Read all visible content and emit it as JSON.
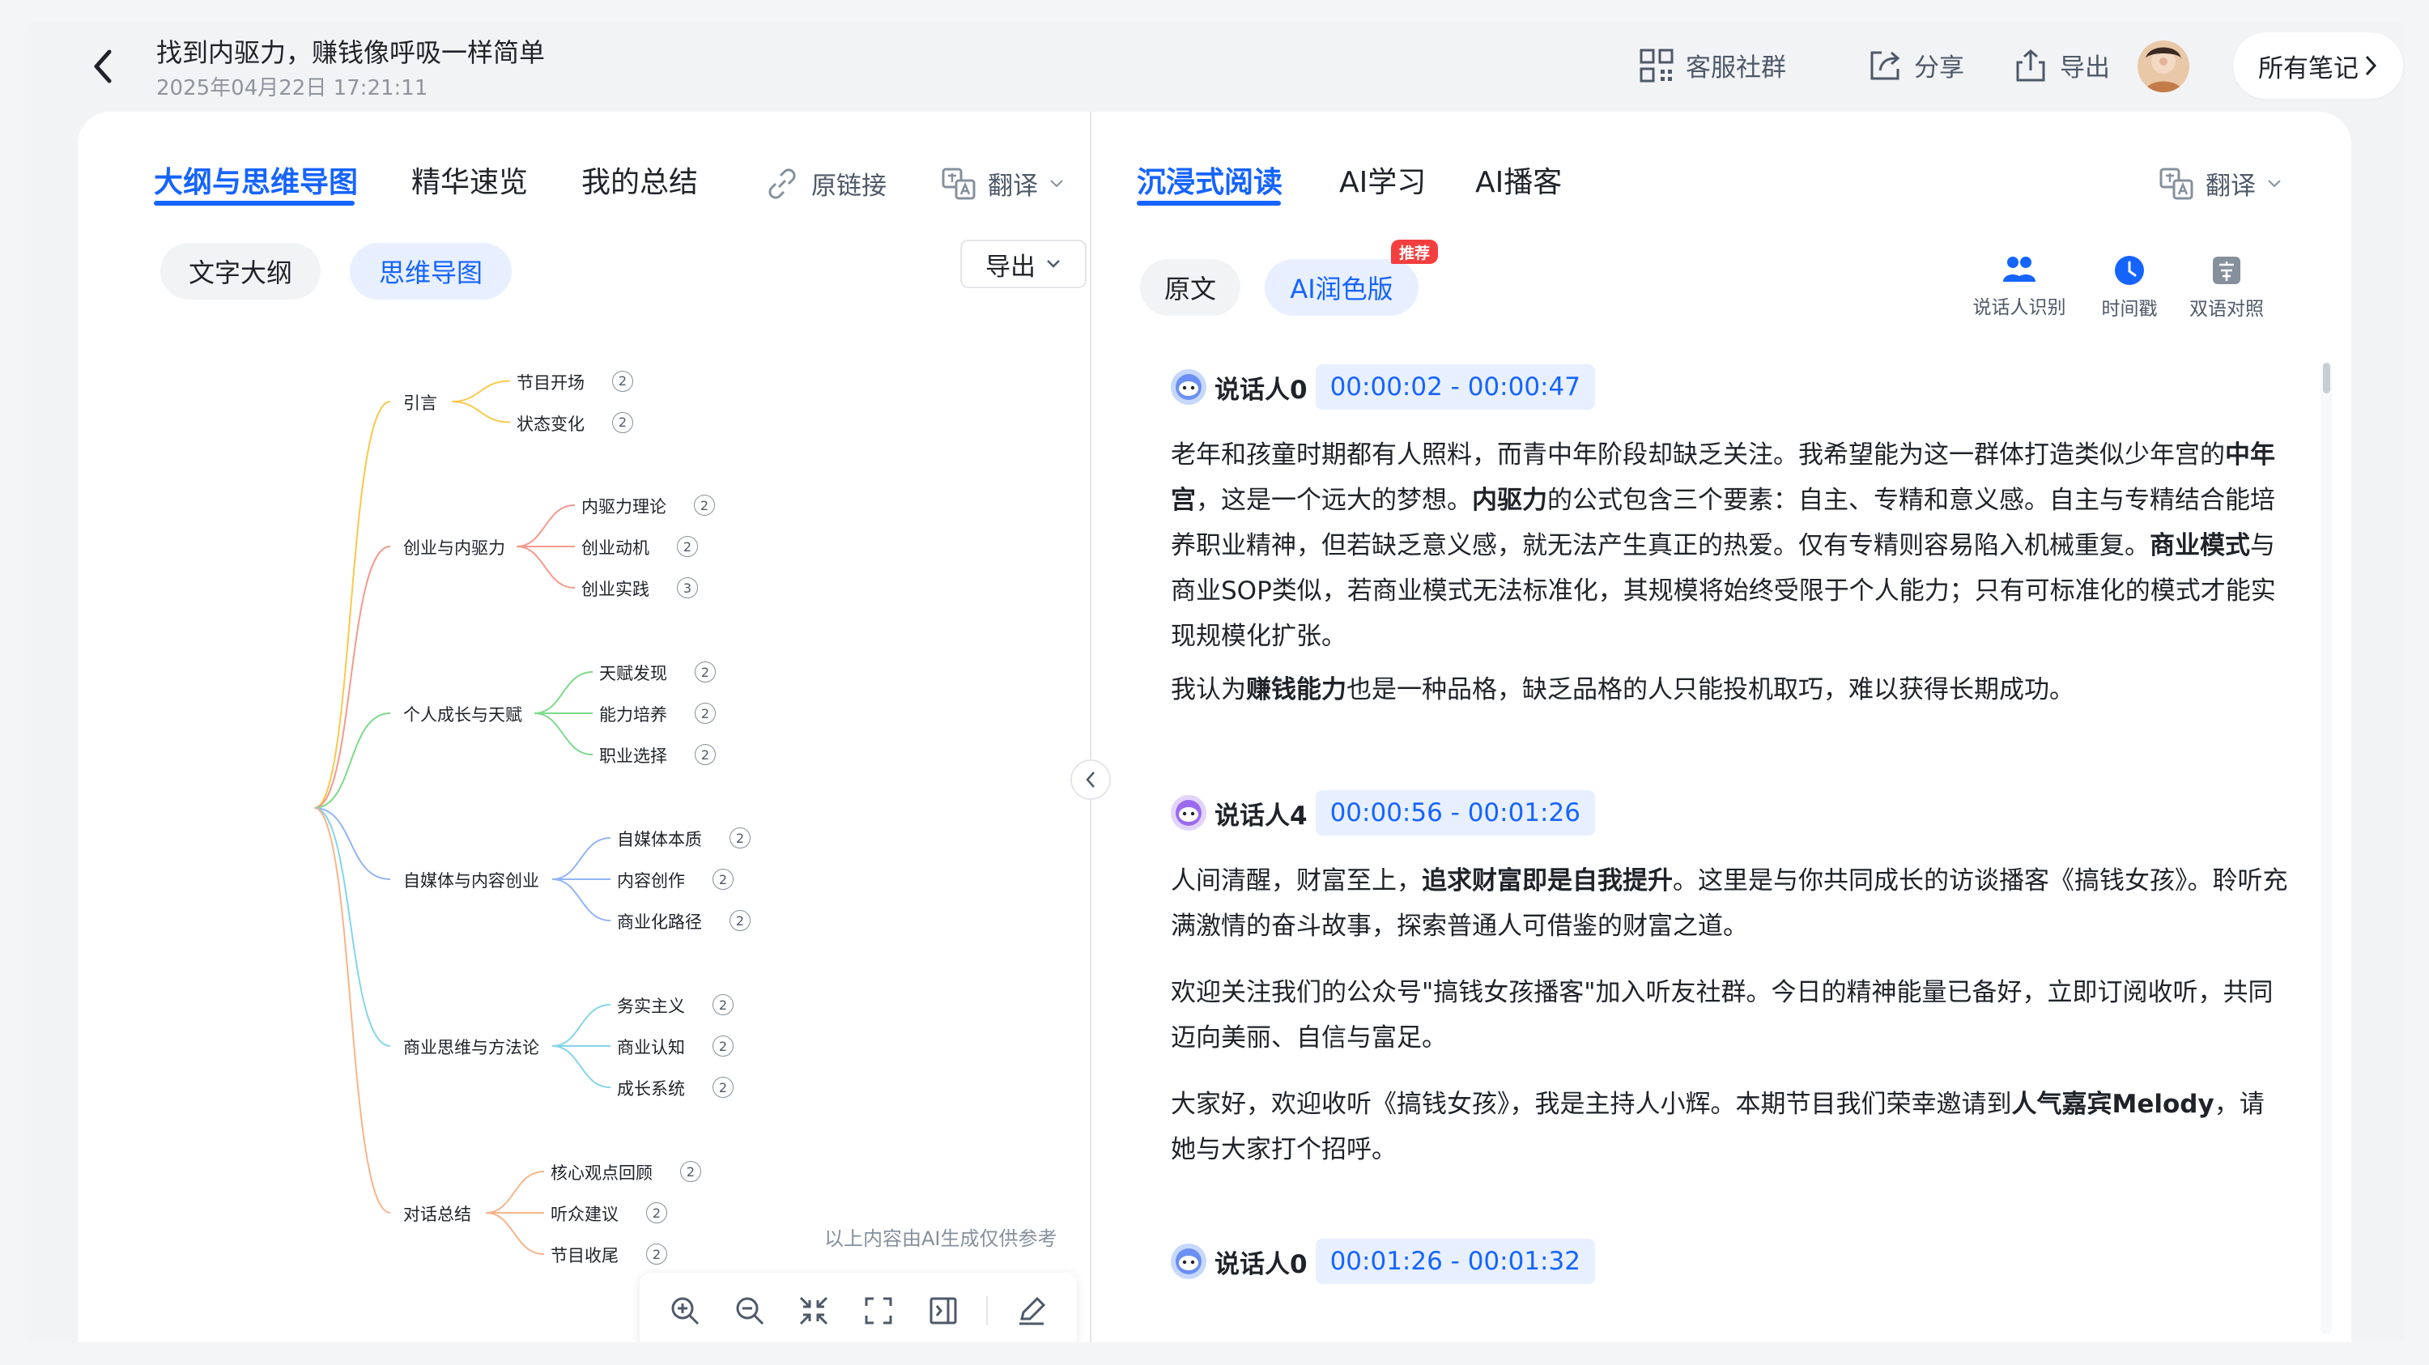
{
  "header": {
    "title": "找到内驱力，赚钱像呼吸一样简单",
    "datetime": "2025年04月22日 17:21:11",
    "actions": {
      "service": "客服社群",
      "share": "分享",
      "export": "导出"
    },
    "all_notes": "所有笔记"
  },
  "left": {
    "tabs": [
      "大纲与思维导图",
      "精华速览",
      "我的总结"
    ],
    "source_link": "原链接",
    "translate": "翻译",
    "mode_pills": [
      "文字大纲",
      "思维导图"
    ],
    "export": "导出",
    "mindmap": {
      "branches": [
        {
          "label": "引言",
          "color": "#f8c94b",
          "children": [
            {
              "label": "节目开场",
              "count": "2"
            },
            {
              "label": "状态变化",
              "count": "2"
            }
          ]
        },
        {
          "label": "创业与内驱力",
          "color": "#f39a8c",
          "children": [
            {
              "label": "内驱力理论",
              "count": "2"
            },
            {
              "label": "创业动机",
              "count": "2"
            },
            {
              "label": "创业实践",
              "count": "3"
            }
          ]
        },
        {
          "label": "个人成长与天赋",
          "color": "#7ed98b",
          "children": [
            {
              "label": "天赋发现",
              "count": "2"
            },
            {
              "label": "能力培养",
              "count": "2"
            },
            {
              "label": "职业选择",
              "count": "2"
            }
          ]
        },
        {
          "label": "自媒体与内容创业",
          "color": "#93b4f5",
          "children": [
            {
              "label": "自媒体本质",
              "count": "2"
            },
            {
              "label": "内容创作",
              "count": "2"
            },
            {
              "label": "商业化路径",
              "count": "2"
            }
          ]
        },
        {
          "label": "商业思维与方法论",
          "color": "#86d4ea",
          "children": [
            {
              "label": "务实主义",
              "count": "2"
            },
            {
              "label": "商业认知",
              "count": "2"
            },
            {
              "label": "成长系统",
              "count": "2"
            }
          ]
        },
        {
          "label": "对话总结",
          "color": "#f7b48a",
          "children": [
            {
              "label": "核心观点回顾",
              "count": "2"
            },
            {
              "label": "听众建议",
              "count": "2"
            },
            {
              "label": "节目收尾",
              "count": "2"
            }
          ]
        }
      ]
    },
    "ai_note": "以上内容由AI生成仅供参考"
  },
  "right": {
    "tabs": [
      "沉浸式阅读",
      "AI学习",
      "AI播客"
    ],
    "translate": "翻译",
    "version_pills": [
      "原文",
      "AI润色版"
    ],
    "recommend_badge": "推荐",
    "tools": [
      "说话人识别",
      "时间戳",
      "双语对照"
    ],
    "segments": [
      {
        "speaker": "说话人0",
        "time": "00:00:02 - 00:00:47",
        "paragraphs": [
          [
            {
              "t": "老年和孩童时期都有人照料，而青中年阶段却缺乏关注。我希望能为这一群体打造类似少年宫的"
            },
            {
              "t": "中年宫",
              "b": true
            },
            {
              "t": "，这是一个远大的梦想。"
            },
            {
              "t": "内驱力",
              "b": true
            },
            {
              "t": "的公式包含三个要素：自主、专精和意义感。自主与专精结合能培养职业精神，但若缺乏意义感，就无法产生真正的热爱。仅有专精则容易陷入机械重复。"
            },
            {
              "t": "商业模式",
              "b": true
            },
            {
              "t": "与商业SOP类似，若商业模式无法标准化，其规模将始终受限于个人能力；只有可标准化的模式才能实现规模化扩张。"
            }
          ],
          [
            {
              "t": "我认为"
            },
            {
              "t": "赚钱能力",
              "b": true
            },
            {
              "t": "也是一种品格，缺乏品格的人只能投机取巧，难以获得长期成功。"
            }
          ]
        ]
      },
      {
        "speaker": "说话人4",
        "time": "00:00:56 - 00:01:26",
        "paragraphs": [
          [
            {
              "t": "人间清醒，财富至上，"
            },
            {
              "t": "追求财富即是自我提升",
              "b": true
            },
            {
              "t": "。这里是与你共同成长的访谈播客《搞钱女孩》。聆听充满激情的奋斗故事，探索普通人可借鉴的财富之道。"
            }
          ],
          [
            {
              "t": "欢迎关注我们的公众号\"搞钱女孩播客\"加入听友社群。今日的精神能量已备好，立即订阅收听，共同迈向美丽、自信与富足。"
            }
          ],
          [
            {
              "t": "大家好，欢迎收听《搞钱女孩》，我是主持人小辉。本期节目我们荣幸邀请到"
            },
            {
              "t": "人气嘉宾Melody",
              "b": true
            },
            {
              "t": "，请她与大家打个招呼。"
            }
          ]
        ]
      },
      {
        "speaker": "说话人0",
        "time": "00:01:26 - 00:01:32",
        "paragraphs": []
      }
    ]
  },
  "colors": {
    "accent": "#1664ff",
    "recommend": "#f53f3f"
  }
}
